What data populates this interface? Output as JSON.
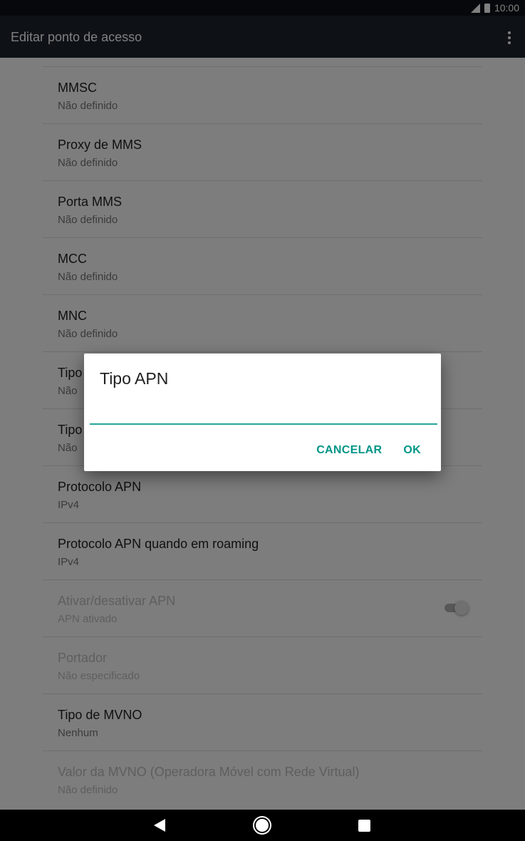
{
  "status_bar": {
    "time": "10:00"
  },
  "app_bar": {
    "title": "Editar ponto de acesso"
  },
  "preferences": [
    {
      "title": "MMSC",
      "summary": "Não definido"
    },
    {
      "title": "Proxy de MMS",
      "summary": "Não definido"
    },
    {
      "title": "Porta MMS",
      "summary": "Não definido"
    },
    {
      "title": "MCC",
      "summary": "Não definido"
    },
    {
      "title": "MNC",
      "summary": "Não definido"
    },
    {
      "title": "Tipo",
      "summary": "Não"
    },
    {
      "title": "Tipo",
      "summary": "Não"
    },
    {
      "title": "Protocolo APN",
      "summary": "IPv4"
    },
    {
      "title": "Protocolo APN quando em roaming",
      "summary": "IPv4"
    },
    {
      "title": "Ativar/desativar APN",
      "summary": "APN ativado",
      "toggle": true
    },
    {
      "title": "Portador",
      "summary": "Não especificado"
    },
    {
      "title": "Tipo de MVNO",
      "summary": "Nenhum"
    },
    {
      "title": "Valor da MVNO (Operadora Móvel com Rede Virtual)",
      "summary": "Não definido"
    }
  ],
  "dialog": {
    "title": "Tipo APN",
    "input_value": "",
    "cancel_label": "CANCELAR",
    "ok_label": "OK"
  },
  "colors": {
    "accent": "#009688",
    "app_bar": "#1c242e",
    "status_bar": "#0d1117"
  },
  "nav": {
    "icons": [
      "back-icon",
      "home-icon",
      "recents-icon"
    ]
  }
}
